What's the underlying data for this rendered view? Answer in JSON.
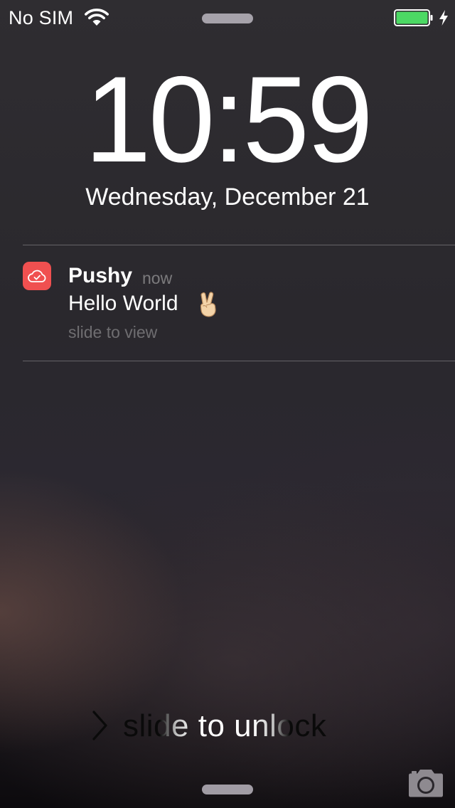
{
  "status_bar": {
    "carrier": "No SIM",
    "wifi_icon": "wifi-icon",
    "battery_icon": "battery-icon",
    "charging_icon": "charging-bolt-icon",
    "battery_level": 1.0,
    "battery_color": "#4cd964"
  },
  "lock_screen": {
    "time": "10:59",
    "date": "Wednesday, December 21"
  },
  "notification": {
    "app_icon": "cloud-check-icon",
    "app_icon_color": "#f05050",
    "app_name": "Pushy",
    "time": "now",
    "message": "Hello World",
    "emoji": "✌🏻",
    "action": "slide to view"
  },
  "unlock": {
    "chevron_icon": "chevron-right-icon",
    "label": "slide to unlock"
  },
  "camera": {
    "icon": "camera-icon"
  }
}
